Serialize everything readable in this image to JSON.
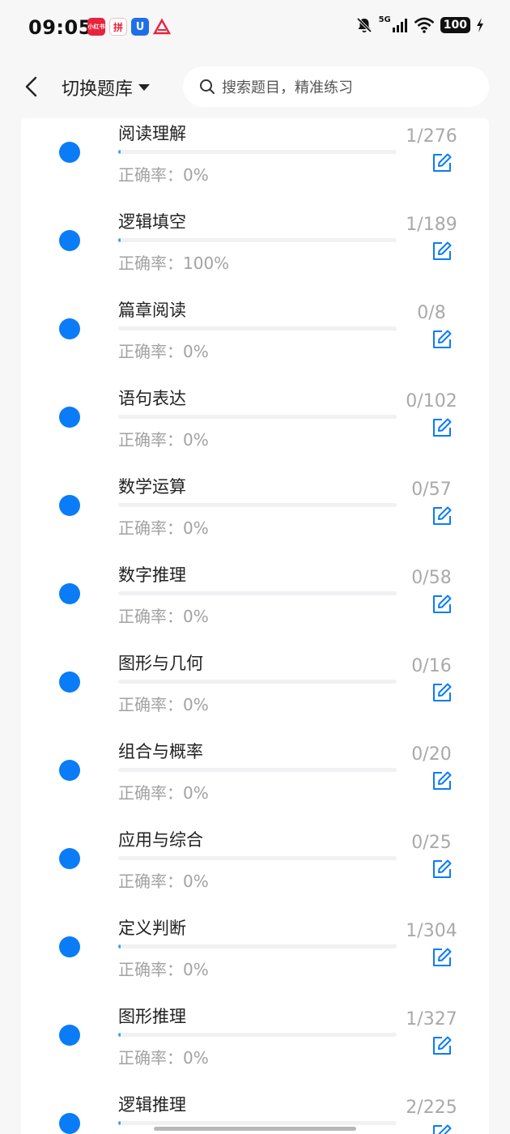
{
  "status_bar": {
    "time": "09:05",
    "app_icons": [
      "小红书",
      "拼",
      "U",
      "△"
    ],
    "network": "5G",
    "battery": "100"
  },
  "header": {
    "title": "切换题库",
    "search_placeholder": "搜索题目，精准练习"
  },
  "accuracy_label": "正确率：",
  "categories": [
    {
      "name": "阅读理解",
      "accuracy": "0%",
      "count": "1/276",
      "progress": 0.0036
    },
    {
      "name": "逻辑填空",
      "accuracy": "100%",
      "count": "1/189",
      "progress": 0.0053
    },
    {
      "name": "篇章阅读",
      "accuracy": "0%",
      "count": "0/8",
      "progress": 0
    },
    {
      "name": "语句表达",
      "accuracy": "0%",
      "count": "0/102",
      "progress": 0
    },
    {
      "name": "数学运算",
      "accuracy": "0%",
      "count": "0/57",
      "progress": 0
    },
    {
      "name": "数字推理",
      "accuracy": "0%",
      "count": "0/58",
      "progress": 0
    },
    {
      "name": "图形与几何",
      "accuracy": "0%",
      "count": "0/16",
      "progress": 0
    },
    {
      "name": "组合与概率",
      "accuracy": "0%",
      "count": "0/20",
      "progress": 0
    },
    {
      "name": "应用与综合",
      "accuracy": "0%",
      "count": "0/25",
      "progress": 0
    },
    {
      "name": "定义判断",
      "accuracy": "0%",
      "count": "1/304",
      "progress": 0.0033
    },
    {
      "name": "图形推理",
      "accuracy": "0%",
      "count": "1/327",
      "progress": 0.0031
    },
    {
      "name": "逻辑推理",
      "accuracy": "",
      "count": "2/225",
      "progress": 0.0089
    }
  ],
  "colors": {
    "accent": "#0a7cf7",
    "progress_fill": "#3aa0f2",
    "muted_text": "#a2a2a2"
  },
  "icons": {
    "back": "chevron-left-icon",
    "dropdown": "caret-down-icon",
    "search": "search-icon",
    "edit": "edit-note-icon"
  }
}
